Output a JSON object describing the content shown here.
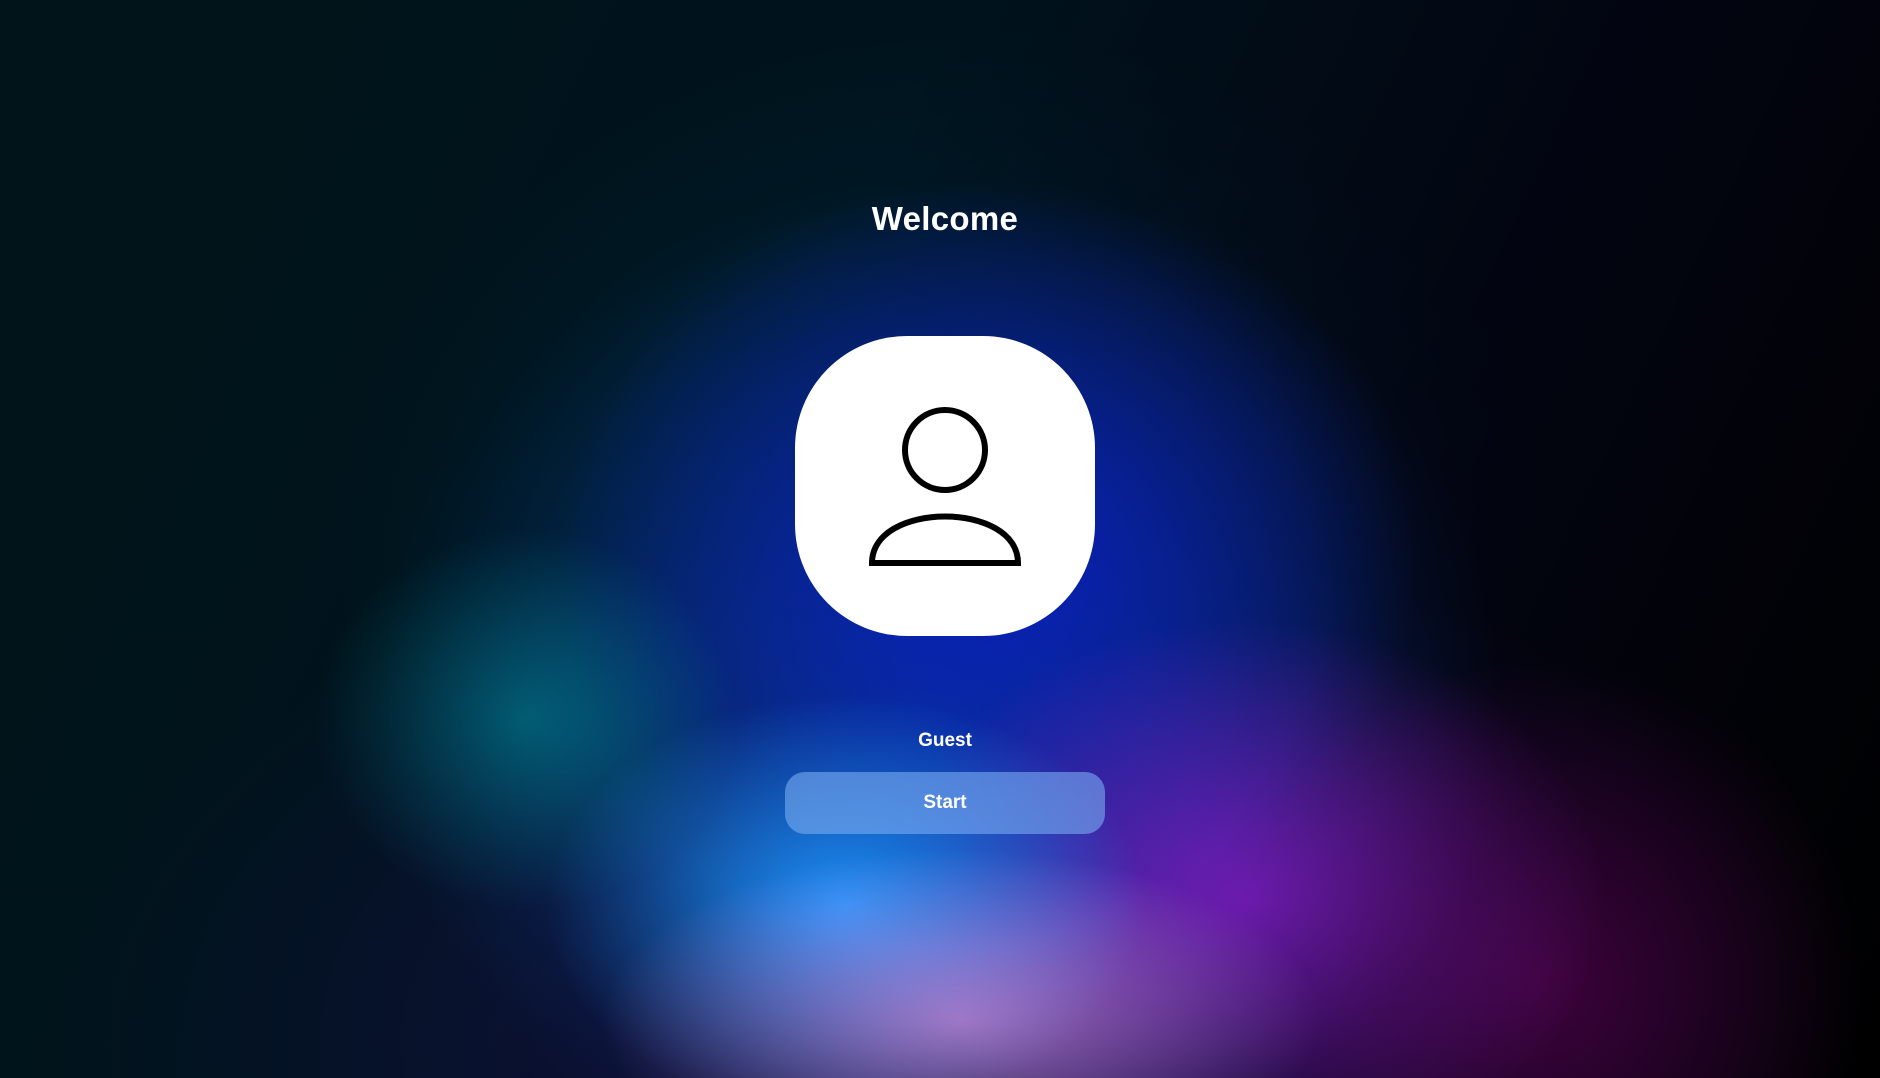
{
  "login": {
    "title": "Welcome",
    "avatar_icon": "user-icon",
    "username": "Guest",
    "start_label": "Start"
  },
  "colors": {
    "avatar_background": "#ffffff",
    "button_background": "#78aaf0",
    "text": "#ffffff"
  }
}
